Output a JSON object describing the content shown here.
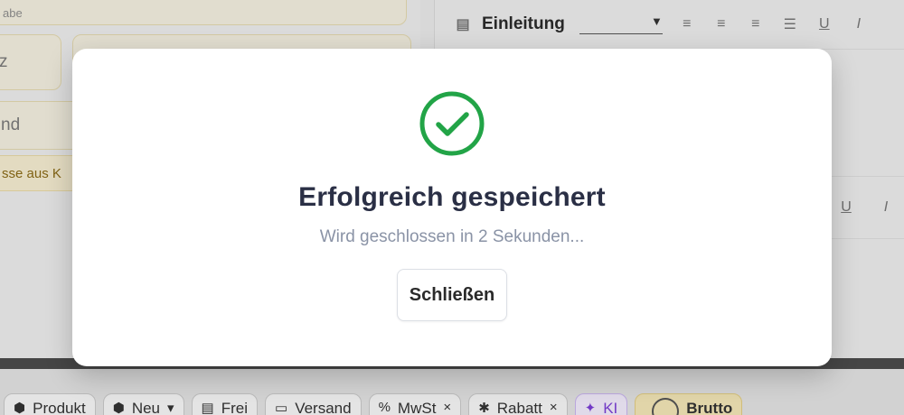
{
  "background": {
    "left_form": {
      "field_top_label": "abe",
      "field_small_text": "z",
      "field_row_text": "nd",
      "hint_text": "sse aus K"
    },
    "editor": {
      "heading_select_value": "Einleitung",
      "format_icons": [
        "align-left-icon",
        "align-center-icon",
        "align-right-icon",
        "list-icon",
        "underline-icon",
        "italic-icon"
      ],
      "underline_glyph": "U",
      "italic_glyph": "I"
    },
    "bottom_toolbar": {
      "chips": [
        {
          "label": "Produkt",
          "icon": "box-icon"
        },
        {
          "label": "Neu",
          "icon": "box-icon"
        },
        {
          "label": "Frei",
          "icon": "document-icon"
        },
        {
          "label": "Versand",
          "icon": "truck-icon"
        },
        {
          "label": "MwSt",
          "icon": "percent-icon"
        },
        {
          "label": "Rabatt",
          "icon": "badge-icon"
        },
        {
          "label": "KI",
          "icon": "sparkle-icon"
        }
      ],
      "brutto_label": "Brutto"
    }
  },
  "modal": {
    "icon": "check-circle-icon",
    "title": "Erfolgreich gespeichert",
    "subtitle": "Wird geschlossen in 2 Sekunden...",
    "close_label": "Schließen",
    "accent_color": "#22a447"
  }
}
